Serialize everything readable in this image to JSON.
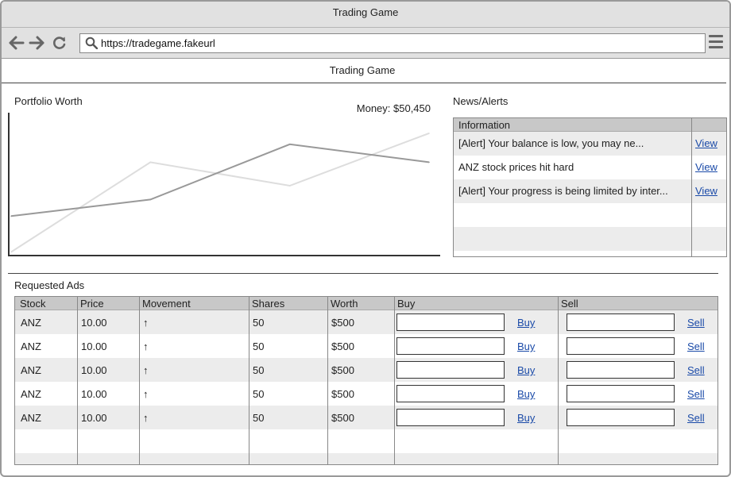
{
  "browser": {
    "window_title": "Trading Game",
    "url": "https://tradegame.fakeurl"
  },
  "app": {
    "title": "Trading Game"
  },
  "portfolio": {
    "label": "Portfolio Worth",
    "money_label": "Money: $50,450"
  },
  "chart_data": {
    "type": "line",
    "title": "Portfolio Worth",
    "xlabel": "",
    "ylabel": "",
    "x": [
      0,
      1,
      2,
      3
    ],
    "ylim": [
      0,
      100
    ],
    "grid": false,
    "series": [
      {
        "color": "#999999",
        "values": [
          28,
          40,
          80,
          67
        ]
      },
      {
        "color": "#dddddd",
        "values": [
          2,
          67,
          50,
          88
        ]
      }
    ]
  },
  "news": {
    "label": "News/Alerts",
    "header": "Information",
    "rows": [
      {
        "text": "[Alert] Your balance is low, you may ne...",
        "link": "View"
      },
      {
        "text": "ANZ stock prices hit hard",
        "link": "View"
      },
      {
        "text": "[Alert] Your progress is being limited by inter...",
        "link": "View"
      }
    ]
  },
  "ads": {
    "label": "Requested Ads",
    "columns": [
      "Stock",
      "Price",
      "Movement",
      "Shares",
      "Worth",
      "Buy",
      "Sell"
    ],
    "rows": [
      {
        "stock": "ANZ",
        "price": "10.00",
        "movement": "↑",
        "shares": "50",
        "worth": "$500",
        "buy_label": "Buy",
        "sell_label": "Sell"
      },
      {
        "stock": "ANZ",
        "price": "10.00",
        "movement": "↑",
        "shares": "50",
        "worth": "$500",
        "buy_label": "Buy",
        "sell_label": "Sell"
      },
      {
        "stock": "ANZ",
        "price": "10.00",
        "movement": "↑",
        "shares": "50",
        "worth": "$500",
        "buy_label": "Buy",
        "sell_label": "Sell"
      },
      {
        "stock": "ANZ",
        "price": "10.00",
        "movement": "↑",
        "shares": "50",
        "worth": "$500",
        "buy_label": "Buy",
        "sell_label": "Sell"
      },
      {
        "stock": "ANZ",
        "price": "10.00",
        "movement": "↑",
        "shares": "50",
        "worth": "$500",
        "buy_label": "Buy",
        "sell_label": "Sell"
      }
    ]
  }
}
